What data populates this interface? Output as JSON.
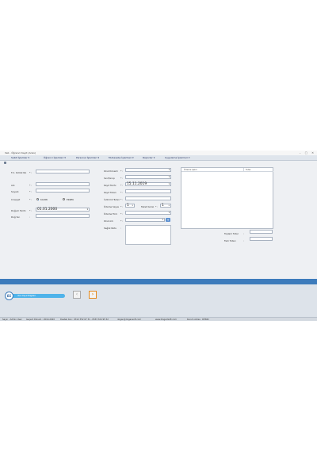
{
  "window": {
    "title": "Veli - Öğrenci Kayıt (Arsiv)",
    "buttons": "– ▢ ✕"
  },
  "menu": [
    "Sabit İşlemler ▾",
    "Öğrenci İşlemleri ▾",
    "Personel İşlemleri ▾",
    "Muhasebe İşlemleri ▾",
    "Raporlar ▾",
    "Uygulama İşlemleri ▾"
  ],
  "form_left": {
    "tc_label": "T.C. Kimlik No",
    "ad_label": "Adı",
    "soyad_label": "Soyadı",
    "cinsiyet_label": "Cinsiyet",
    "cinsiyet_kadin": "KADIN",
    "cinsiyet_erkek": "ERKEK",
    "dogum_label": "Doğum Tarihi",
    "dogum_value": "01.01.2000",
    "dogum_yeri_label": "Doğ.Yer."
  },
  "form_mid": {
    "okul_donemi_label": "Okul Dönemi",
    "sinif_label": "Sınıf/Grup",
    "kayit_tarihi_label": "Kayıt Tarihi",
    "kayit_tarihi_value": "15.11.2019",
    "kayit_tutari_label": "Kayıt Tutarı",
    "indirim_label": "İndirimli Tutarı",
    "odeme_sayisi_label": "Ödeme Sayısı",
    "odeme_sayisi_value": "1",
    "taksit_gunu_label": "Taksit Günü",
    "taksit_gunu_value": "1",
    "odeme_turu_label": "Ödeme Türü",
    "okul_adi_label": "Okul Adı",
    "saglik_label": "Sağlık Notu"
  },
  "right_panel": {
    "col1": "Ödeme Şekli",
    "col2": "Tutar",
    "toplam_label": "Toplam Tutar",
    "fark_label": "Fark Tutarı"
  },
  "bottom": {
    "badge_text": "Yeni Kayıt Bilgileri",
    "badge_letter": "01",
    "prev_glyph": "‹",
    "next_glyph": "›"
  },
  "status": [
    "Sayın : Admin User",
    "Geçerli Dönem : 2019-2020",
    "Destek Ilan : 0312 352 67 31 - 0533 324 95 52",
    "dogan@dogansoft.com",
    "www.DoganSoft.com",
    "Kurum Adres : DENIO"
  ],
  "colors": {
    "accent": "#3d7cbc",
    "badge": "#4fb3ea",
    "next_arrow": "#e58a1f"
  },
  "icons": [
    "sepet-icon",
    "calendar-icon",
    "add-icon"
  ]
}
